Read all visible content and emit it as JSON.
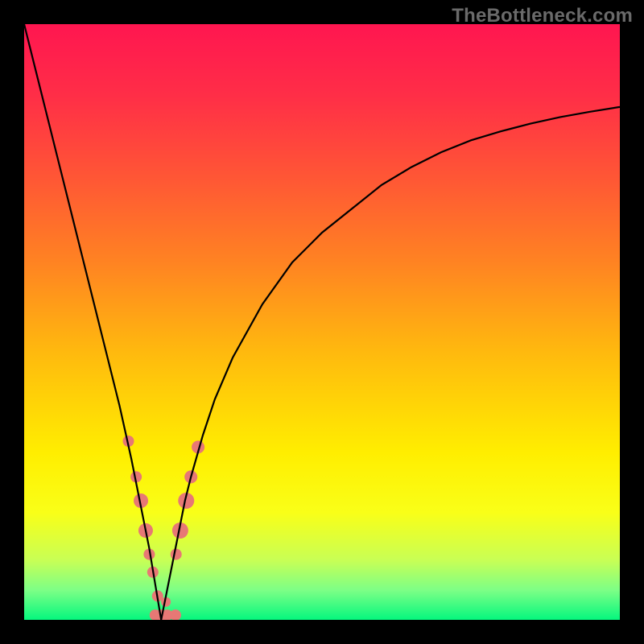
{
  "watermark": "TheBottleneck.com",
  "colors": {
    "frame": "#000000",
    "curve": "#000000",
    "marker": "#e77875",
    "gradient_stops": [
      {
        "pos": 0.0,
        "color": "#ff1650"
      },
      {
        "pos": 0.12,
        "color": "#ff2e47"
      },
      {
        "pos": 0.25,
        "color": "#ff5436"
      },
      {
        "pos": 0.4,
        "color": "#ff8322"
      },
      {
        "pos": 0.55,
        "color": "#ffb90e"
      },
      {
        "pos": 0.72,
        "color": "#ffee00"
      },
      {
        "pos": 0.82,
        "color": "#f9ff18"
      },
      {
        "pos": 0.9,
        "color": "#c8ff55"
      },
      {
        "pos": 0.95,
        "color": "#7dff86"
      },
      {
        "pos": 1.0,
        "color": "#05f77e"
      }
    ]
  },
  "chart_data": {
    "type": "line",
    "title": "",
    "xlabel": "",
    "ylabel": "",
    "xlim": [
      0,
      100
    ],
    "ylim": [
      0,
      100
    ],
    "grid": false,
    "optimum_x": 23,
    "series": [
      {
        "name": "bottleneck-curve",
        "x": [
          0,
          2,
          4,
          6,
          8,
          10,
          12,
          14,
          16,
          18,
          20,
          21,
          22,
          23,
          24,
          25,
          26,
          27,
          28,
          30,
          32,
          35,
          40,
          45,
          50,
          55,
          60,
          65,
          70,
          75,
          80,
          85,
          90,
          95,
          100
        ],
        "y": [
          100,
          92,
          84,
          76,
          68,
          60,
          52,
          44,
          36,
          27,
          17,
          12,
          6,
          0,
          5,
          10,
          15,
          20,
          24,
          31,
          37,
          44,
          53,
          60,
          65,
          69,
          73,
          76,
          78.5,
          80.5,
          82,
          83.3,
          84.4,
          85.3,
          86.1
        ]
      }
    ],
    "markers": [
      {
        "x": 17.5,
        "y": 30,
        "r": 7
      },
      {
        "x": 18.8,
        "y": 24,
        "r": 7
      },
      {
        "x": 19.6,
        "y": 20,
        "r": 9
      },
      {
        "x": 20.4,
        "y": 15,
        "r": 9
      },
      {
        "x": 21.0,
        "y": 11,
        "r": 7
      },
      {
        "x": 21.6,
        "y": 8,
        "r": 7
      },
      {
        "x": 22.4,
        "y": 4,
        "r": 7
      },
      {
        "x": 26.2,
        "y": 15,
        "r": 10
      },
      {
        "x": 27.2,
        "y": 20,
        "r": 10
      },
      {
        "x": 28.0,
        "y": 24,
        "r": 8
      },
      {
        "x": 29.2,
        "y": 29,
        "r": 8
      },
      {
        "x": 22.0,
        "y": 0.8,
        "r": 7
      },
      {
        "x": 23.0,
        "y": 0.8,
        "r": 7
      },
      {
        "x": 24.0,
        "y": 0.8,
        "r": 7
      },
      {
        "x": 25.4,
        "y": 0.8,
        "r": 7
      },
      {
        "x": 25.5,
        "y": 11,
        "r": 7
      },
      {
        "x": 23.8,
        "y": 3,
        "r": 6
      }
    ]
  }
}
